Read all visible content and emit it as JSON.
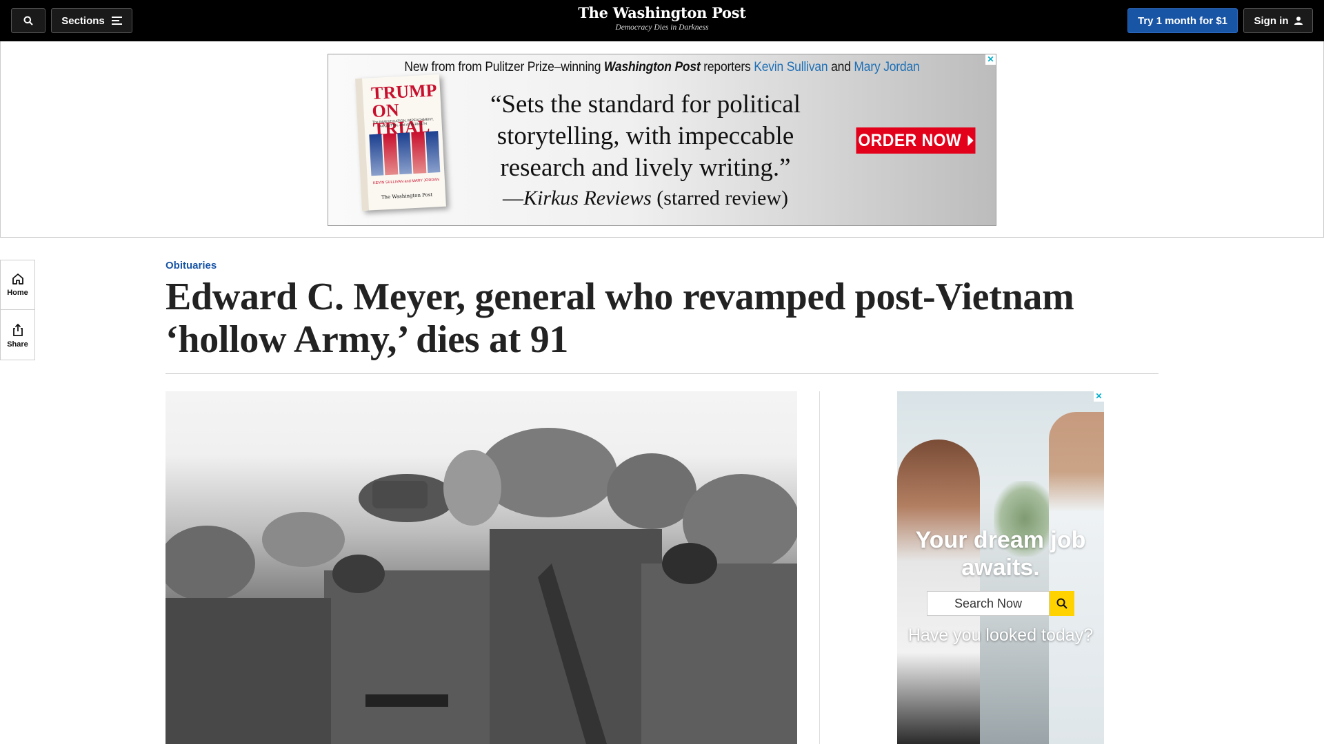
{
  "header": {
    "sections_label": "Sections",
    "logo": "The Washington Post",
    "tagline": "Democracy Dies in Darkness",
    "try_label": "Try 1 month for $1",
    "signin_label": "Sign in"
  },
  "top_ad": {
    "intro_prefix": "New from from Pulitzer Prize–winning ",
    "intro_pub": "Washington Post",
    "intro_mid": " reporters ",
    "author1": "Kevin Sullivan",
    "intro_and": " and ",
    "author2": "Mary Jordan",
    "quote": "“Sets the standard for political storytelling, with impeccable research and lively writing.”",
    "attrib_dash": "—",
    "attrib_source": "Kirkus Reviews",
    "attrib_note": " (starred review)",
    "cta": "ORDER NOW",
    "book_title": "TRUMP ON TRIAL",
    "book_sub": "The INVESTIGATION, IMPEACHMENT, ACQUITTAL and AFTERMATH",
    "book_authors": "KEVIN SULLIVAN and MARY JORDAN",
    "book_pub": "The Washington Post",
    "ad_close": "✕"
  },
  "rail": {
    "home_label": "Home",
    "share_label": "Share"
  },
  "article": {
    "kicker": "Obituaries",
    "headline": "Edward C. Meyer, general who revamped post-Vietnam ‘hollow Army,’ dies at 91"
  },
  "side_ad": {
    "headline": "Your dream job awaits.",
    "search_placeholder": "Search Now",
    "sub": "Have you looked today?",
    "ad_close": "✕"
  },
  "colors": {
    "nav_bg": "#000000",
    "accent_blue": "#1955a5",
    "ad_red": "#e2001a",
    "ad_yellow": "#ffd200"
  }
}
